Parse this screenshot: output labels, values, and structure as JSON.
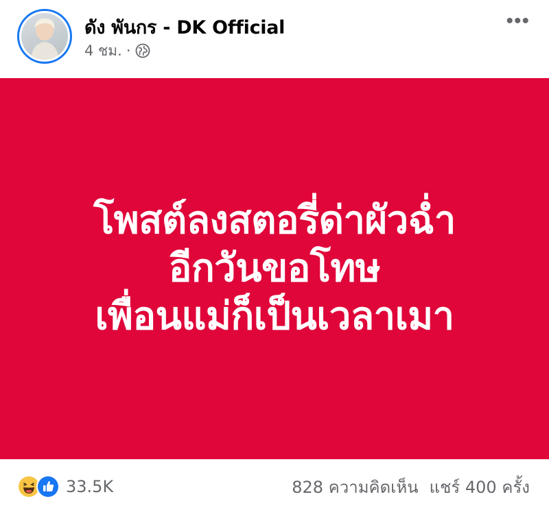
{
  "post": {
    "author": "ดัง พันกร - DK Official",
    "time": "4 ชม.",
    "separator": "·",
    "privacy_icon": "globe-icon",
    "more_icon": "more-options-icon",
    "more_label": "•••"
  },
  "image_text": {
    "lines": [
      "โพสต์ลงสตอรี่ด่าผัวฉ่ำ",
      "อีกวันขอโทษ",
      "เพื่อนแม่ก็เป็นเวลาเมา"
    ],
    "background_color": "#e0063a",
    "text_color": "#ffffff"
  },
  "footer": {
    "reaction_icons": [
      "haha-icon",
      "like-icon"
    ],
    "reaction_count": "33.5K",
    "comments": "828 ความคิดเห็น",
    "shares": "แชร์ 400 ครั้ง"
  },
  "colors": {
    "accent": "#1877f2",
    "secondary_text": "#65676b",
    "primary_text": "#050505"
  }
}
